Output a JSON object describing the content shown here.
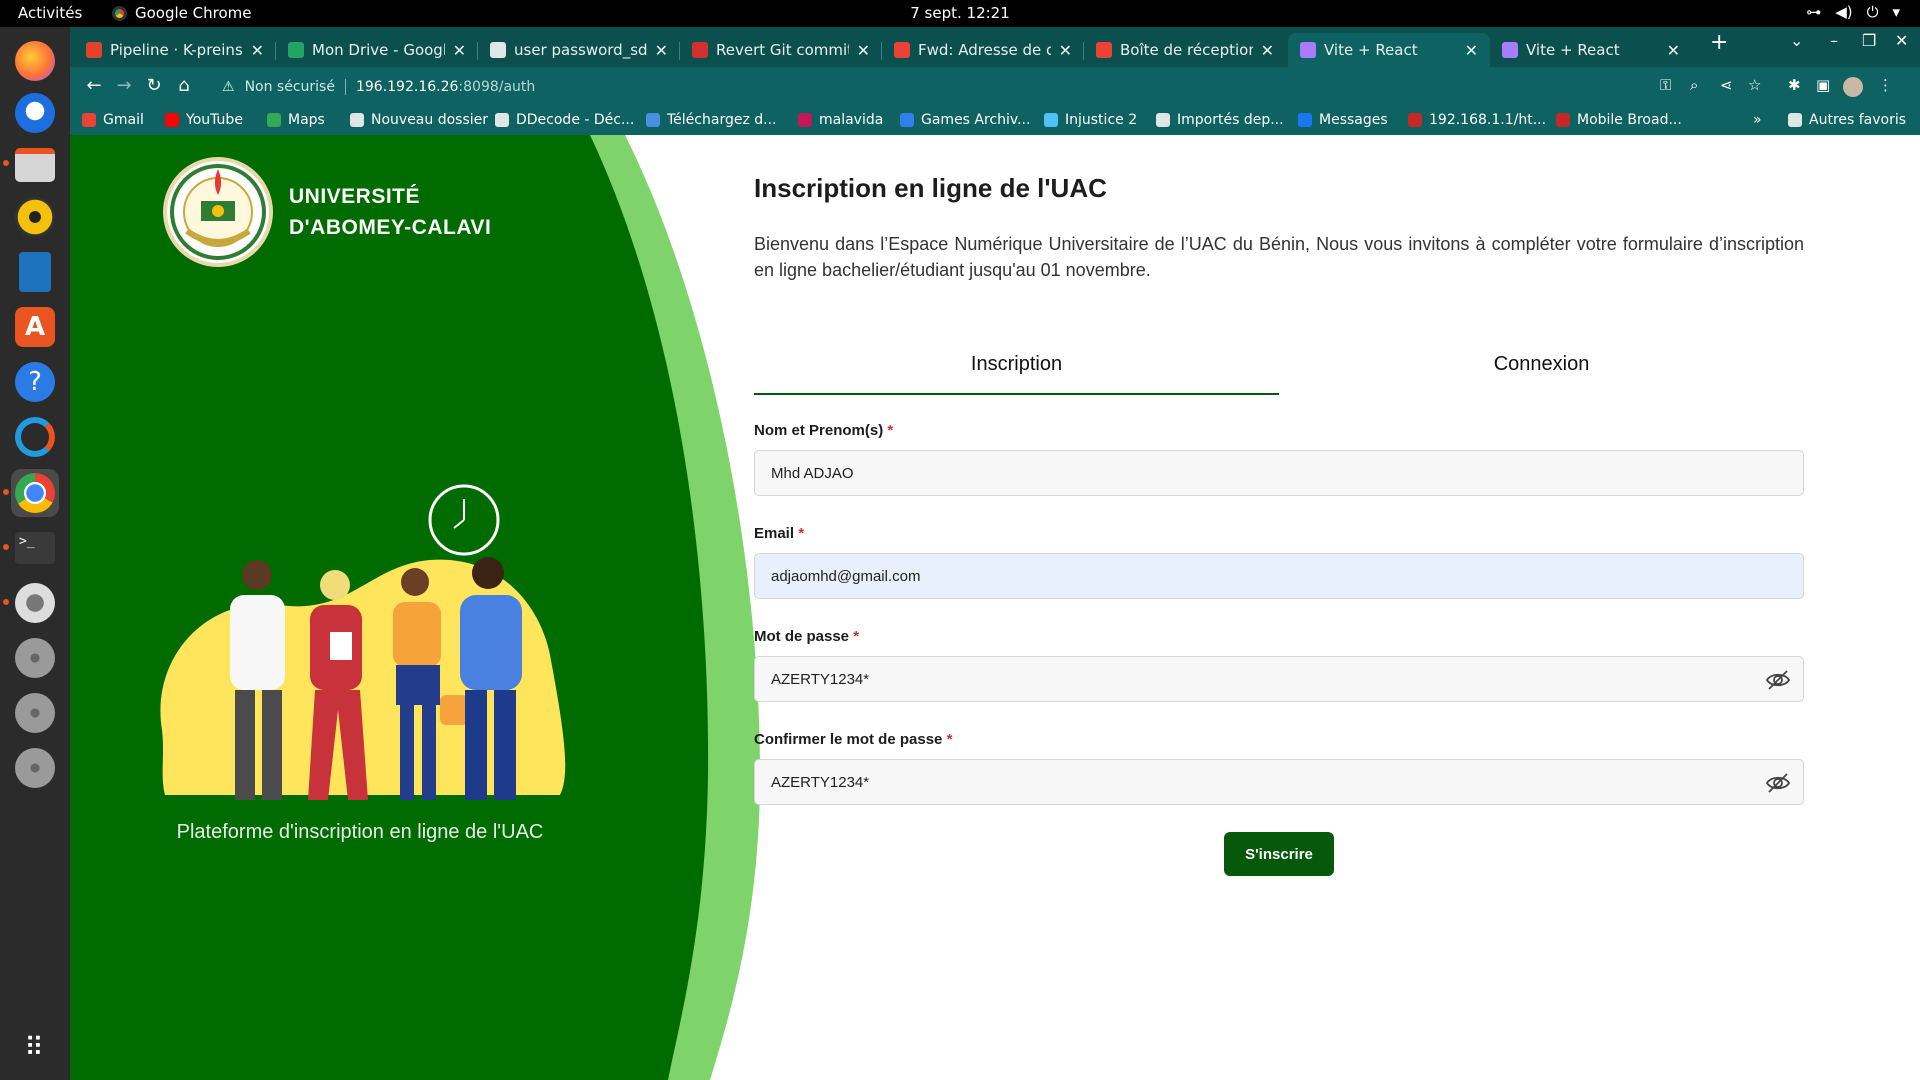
{
  "system": {
    "activities": "Activités",
    "app": "Google Chrome",
    "clock": "7 sept.  12:21"
  },
  "browser": {
    "tabs": [
      {
        "title": "Pipeline · K-preinscri",
        "favicon_color": "#e2432a"
      },
      {
        "title": "Mon Drive - Google D",
        "favicon_color": "#1fa463"
      },
      {
        "title": "user password_sdep",
        "favicon_color": "#dfe6e6"
      },
      {
        "title": "Revert Git commit : r",
        "favicon_color": "#d32f2f"
      },
      {
        "title": "Fwd: Adresse de co",
        "favicon_color": "#ea4335"
      },
      {
        "title": "Boîte de réception (",
        "favicon_color": "#ea4335"
      },
      {
        "title": "Vite + React",
        "favicon_color": "#a87bff"
      },
      {
        "title": "Vite + React",
        "favicon_color": "#a87bff"
      }
    ],
    "active_tab_index": 6,
    "address": {
      "insecure_label": "Non sécurisé",
      "host": "196.192.16.26",
      "path": ":8098/auth"
    },
    "bookmarks": [
      {
        "label": "Gmail",
        "color": "#ea4335"
      },
      {
        "label": "YouTube",
        "color": "#ff0000"
      },
      {
        "label": "Maps",
        "color": "#34a853"
      },
      {
        "label": "Nouveau dossier",
        "color": "#dfe6e6"
      },
      {
        "label": "DDecode - Déc...",
        "color": "#dfe6e6"
      },
      {
        "label": "Téléchargez d...",
        "color": "#4a90e2"
      },
      {
        "label": "malavida",
        "color": "#c2185b"
      },
      {
        "label": "Games Archiv...",
        "color": "#2f80ed"
      },
      {
        "label": "Injustice 2",
        "color": "#4fc3f7"
      },
      {
        "label": "Importés dep...",
        "color": "#dfe6e6"
      },
      {
        "label": "Messages",
        "color": "#1877f2"
      },
      {
        "label": "192.168.1.1/ht...",
        "color": "#c62828"
      },
      {
        "label": "Mobile Broad...",
        "color": "#c62828"
      }
    ],
    "bookmarks_more": "»",
    "other_bookmarks": "Autres favoris"
  },
  "hero": {
    "university_line1": "UNIVERSITÉ",
    "university_line2": "D'ABOMEY-CALAVI",
    "platform_caption": "Plateforme d'inscription en ligne de l'UAC",
    "colors": {
      "dark_green": "#006b00",
      "light_green": "#7ed36b",
      "blob_yellow": "#ffe55c"
    }
  },
  "form": {
    "title": "Inscription en ligne de l'UAC",
    "intro": "Bienvenu dans l’Espace Numérique Universitaire de l’UAC du Bénin, Nous vous invitons à compléter votre formulaire d’inscription en ligne bachelier/étudiant jusqu'au 01 novembre.",
    "tabs": [
      "Inscription",
      "Connexion"
    ],
    "active_tab": "Inscription",
    "fields": {
      "name": {
        "label": "Nom et Prenom(s)",
        "value": "Mhd ADJAO"
      },
      "email": {
        "label": "Email",
        "value": "adjaomhd@gmail.com"
      },
      "password": {
        "label": "Mot de passe",
        "value": "AZERTY1234*"
      },
      "confirm": {
        "label": "Confirmer le mot de passe",
        "value": "AZERTY1234*"
      }
    },
    "required_mark": "*",
    "submit_label": "S'inscrire",
    "accent_color": "#06590b"
  }
}
